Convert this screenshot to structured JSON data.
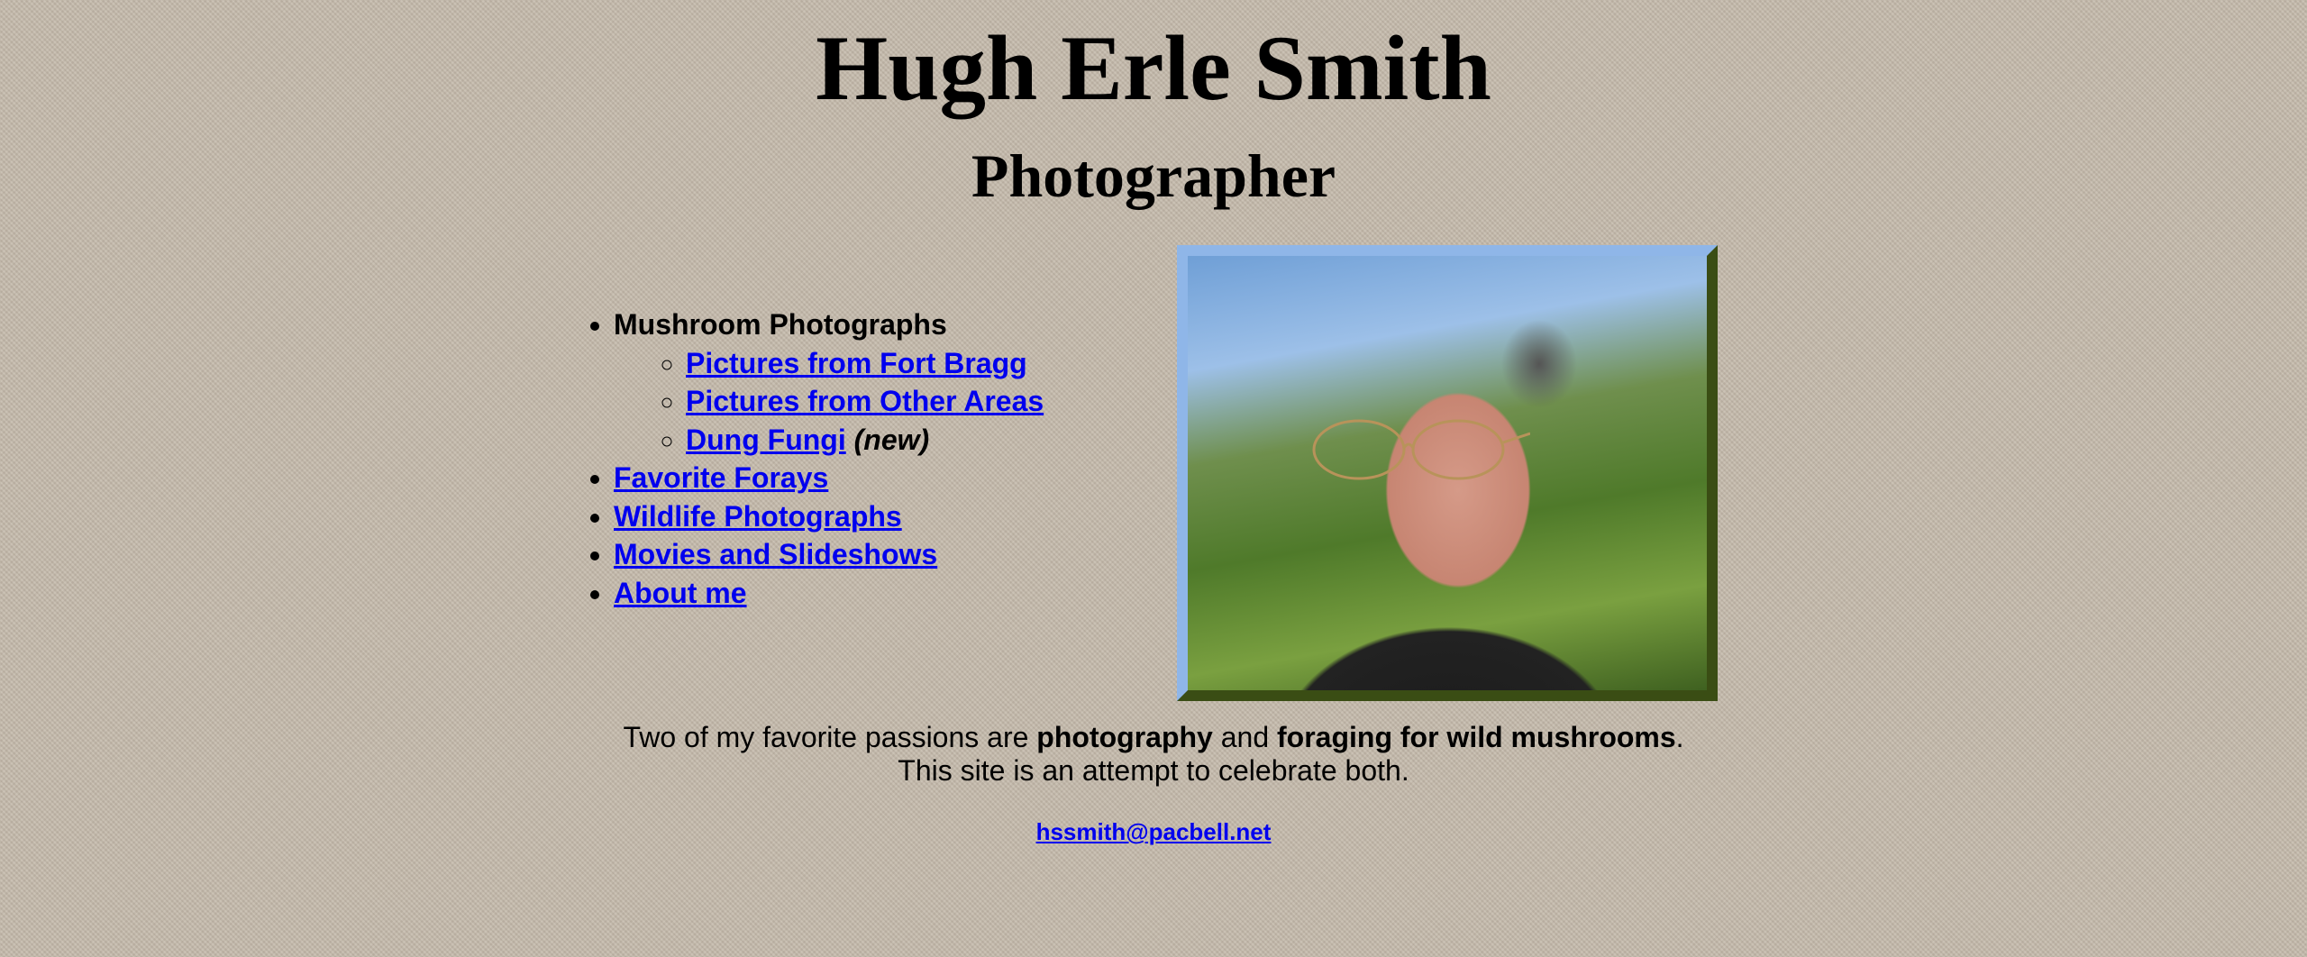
{
  "header": {
    "title": "Hugh Erle Smith",
    "subtitle": "Photographer"
  },
  "nav": {
    "mushroom_heading": "Mushroom Photographs",
    "sub_items": [
      {
        "label": "Pictures from Fort Bragg"
      },
      {
        "label": "Pictures from Other Areas"
      },
      {
        "label": "Dung Fungi",
        "tag": "(new)"
      }
    ],
    "items": [
      {
        "label": "Favorite Forays"
      },
      {
        "label": "Wildlife Photographs"
      },
      {
        "label": "Movies and Slideshows"
      },
      {
        "label": "About me"
      }
    ]
  },
  "intro": {
    "part1": "Two of my favorite passions are ",
    "bold1": "photography",
    "part2": " and ",
    "bold2": "foraging for wild mushrooms",
    "part3": ".",
    "line2": "This site is an attempt to celebrate both."
  },
  "contact": {
    "email": "hssmith@pacbell.net"
  },
  "colors": {
    "background": "#c4b9aa",
    "link": "#0000ee"
  }
}
